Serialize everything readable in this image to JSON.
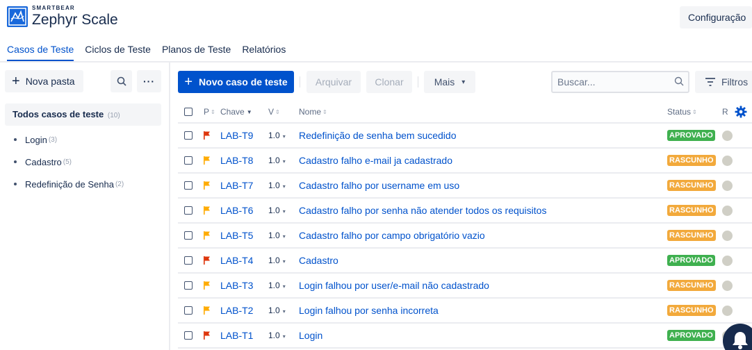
{
  "brand": {
    "small": "SMARTBEAR",
    "name": "Zephyr Scale"
  },
  "header": {
    "config_label": "Configuração"
  },
  "tabs": [
    {
      "label": "Casos de Teste",
      "active": true
    },
    {
      "label": "Ciclos de Teste",
      "active": false
    },
    {
      "label": "Planos de Teste",
      "active": false
    },
    {
      "label": "Relatórios",
      "active": false
    }
  ],
  "sidebar": {
    "new_folder_label": "Nova pasta",
    "more_label": "···",
    "all": {
      "label": "Todos casos de teste",
      "count": "(10)"
    },
    "folders": [
      {
        "label": "Login",
        "count": "(3)"
      },
      {
        "label": "Cadastro",
        "count": "(5)"
      },
      {
        "label": "Redefinição de Senha",
        "count": "(2)"
      }
    ]
  },
  "toolbar": {
    "new_label": "Novo caso de teste",
    "archive_label": "Arquivar",
    "clone_label": "Clonar",
    "more_label": "Mais",
    "search_placeholder": "Buscar...",
    "filters_label": "Filtros"
  },
  "table": {
    "headers": {
      "priority": "P",
      "key": "Chave",
      "version": "V",
      "name": "Nome",
      "status": "Status",
      "r": "R"
    },
    "rows": [
      {
        "priority": "high",
        "key": "LAB-T9",
        "version": "1.0",
        "name": "Redefinição de senha bem sucedido",
        "status": "APROVADO"
      },
      {
        "priority": "normal",
        "key": "LAB-T8",
        "version": "1.0",
        "name": "Cadastro falho e-mail ja cadastrado",
        "status": "RASCUNHO"
      },
      {
        "priority": "normal",
        "key": "LAB-T7",
        "version": "1.0",
        "name": "Cadastro falho por username em uso",
        "status": "RASCUNHO"
      },
      {
        "priority": "normal",
        "key": "LAB-T6",
        "version": "1.0",
        "name": "Cadastro falho por senha não atender todos os requisitos",
        "status": "RASCUNHO"
      },
      {
        "priority": "normal",
        "key": "LAB-T5",
        "version": "1.0",
        "name": "Cadastro falho por campo obrigatório vazio",
        "status": "RASCUNHO"
      },
      {
        "priority": "high",
        "key": "LAB-T4",
        "version": "1.0",
        "name": "Cadastro",
        "status": "APROVADO"
      },
      {
        "priority": "normal",
        "key": "LAB-T3",
        "version": "1.0",
        "name": "Login falhou por user/e-mail não cadastrado",
        "status": "RASCUNHO"
      },
      {
        "priority": "normal",
        "key": "LAB-T2",
        "version": "1.0",
        "name": "Login falhou por senha incorreta",
        "status": "RASCUNHO"
      },
      {
        "priority": "high",
        "key": "LAB-T1",
        "version": "1.0",
        "name": "Login",
        "status": "APROVADO"
      }
    ]
  },
  "colors": {
    "primary": "#0052cc",
    "approved": "#3fb04f",
    "draft": "#f2a93b",
    "flag_high": "#de350b",
    "flag_normal": "#ffab00"
  }
}
